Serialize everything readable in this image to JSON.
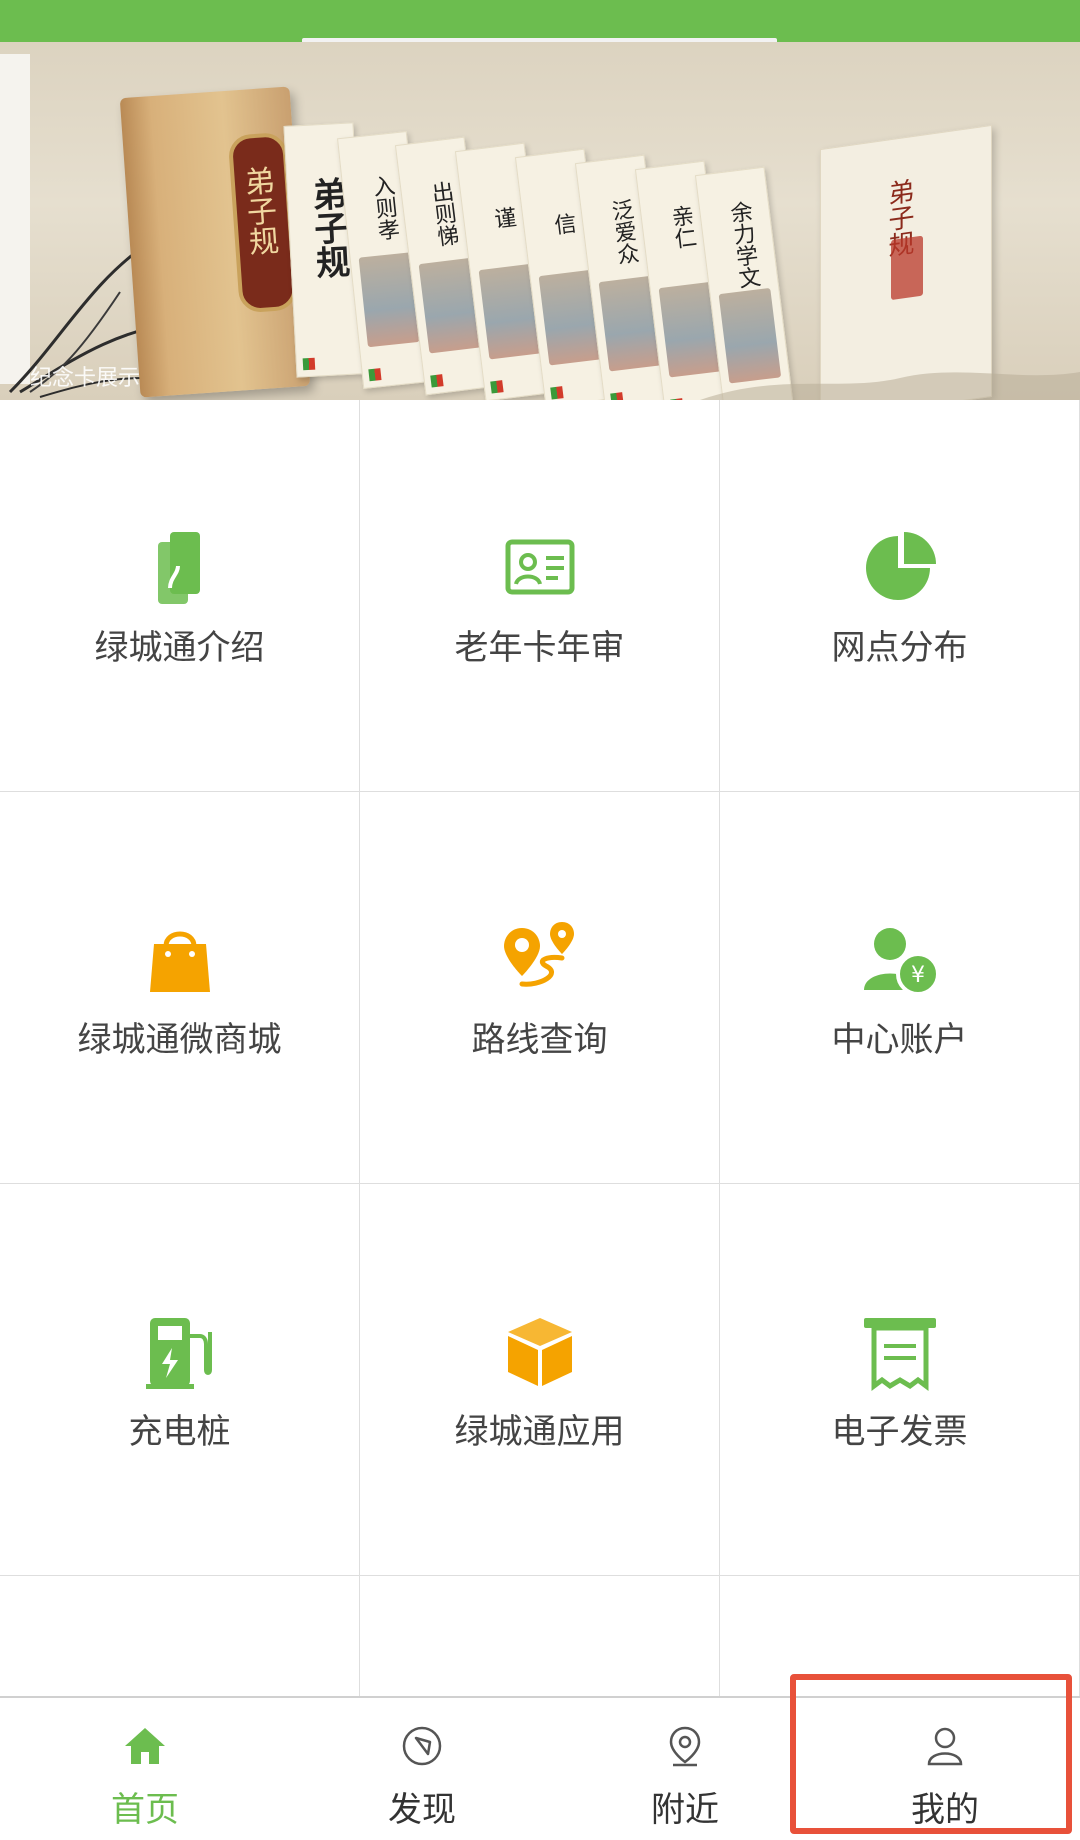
{
  "banner": {
    "caption": "纪念卡展示",
    "slides_total": 3,
    "active_slide": 3,
    "book_title": "弟子规",
    "cards": [
      "弟子规",
      "入则孝",
      "出则悌",
      "谨",
      "信",
      "泛爱众",
      "亲仁",
      "余力学文"
    ],
    "box_title": "弟子规"
  },
  "grid": {
    "items": [
      {
        "label": "绿城通介绍",
        "icon": "card-icon",
        "color": "#6cbd4f"
      },
      {
        "label": "老年卡年审",
        "icon": "id-card-icon",
        "color": "#6cbd4f"
      },
      {
        "label": "网点分布",
        "icon": "pie-chart-icon",
        "color": "#6cbd4f"
      },
      {
        "label": "绿城通微商城",
        "icon": "shopping-bag-icon",
        "color": "#f5a300"
      },
      {
        "label": "路线查询",
        "icon": "route-icon",
        "color": "#f5a300"
      },
      {
        "label": "中心账户",
        "icon": "account-yuan-icon",
        "color": "#6cbd4f"
      },
      {
        "label": "充电桩",
        "icon": "charging-pile-icon",
        "color": "#6cbd4f"
      },
      {
        "label": "绿城通应用",
        "icon": "box-icon",
        "color": "#f5a300"
      },
      {
        "label": "电子发票",
        "icon": "invoice-icon",
        "color": "#6cbd4f"
      }
    ]
  },
  "tabbar": {
    "items": [
      {
        "label": "首页",
        "icon": "home-icon",
        "active": true
      },
      {
        "label": "发现",
        "icon": "compass-icon",
        "active": false
      },
      {
        "label": "附近",
        "icon": "location-pin-icon",
        "active": false
      },
      {
        "label": "我的",
        "icon": "user-icon",
        "active": false
      }
    ]
  },
  "colors": {
    "brand_green": "#6cbd4f",
    "accent_orange": "#f5a300",
    "highlight_red": "#e8513a",
    "text_gray": "#444444"
  }
}
